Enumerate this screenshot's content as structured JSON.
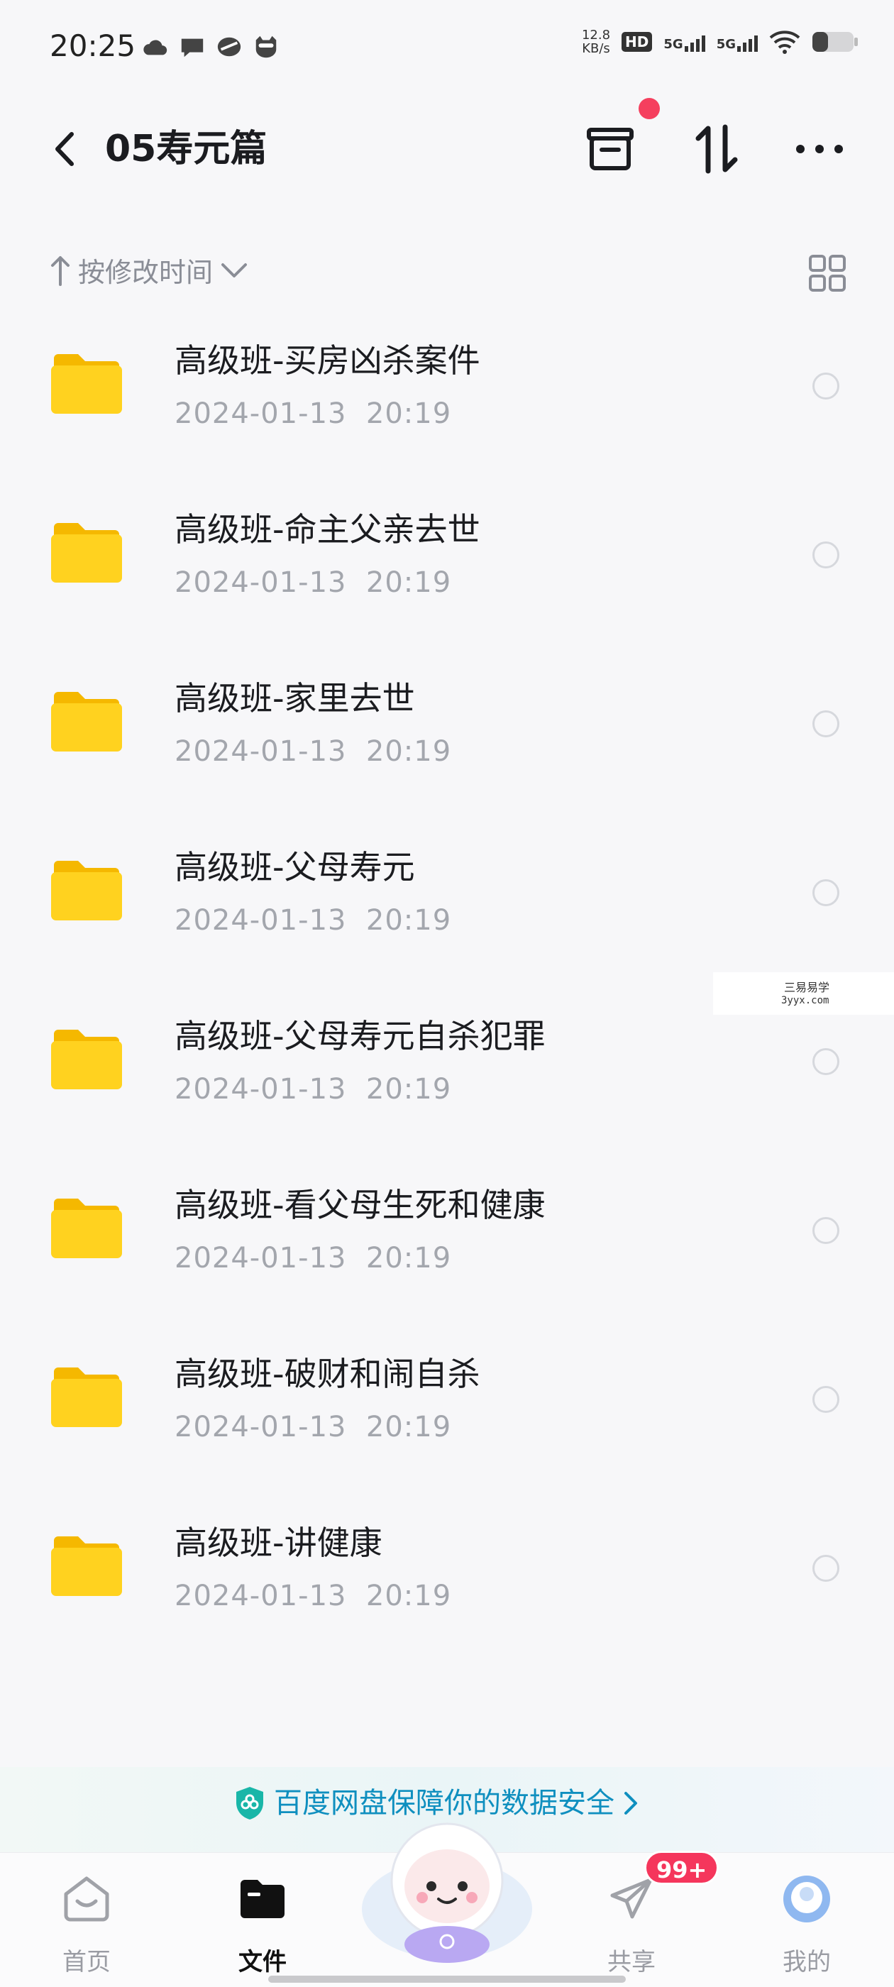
{
  "status_bar": {
    "time": "20:25",
    "net_speed_value": "12.8",
    "net_speed_unit": "KB/s",
    "hd_label": "HD",
    "sim1_label": "5G",
    "sim2_label": "5G",
    "left_icons": [
      "cloud-icon",
      "chat-icon",
      "app-icon",
      "cat-icon"
    ],
    "battery_level": 0.35
  },
  "header": {
    "title": "05寿元篇",
    "back_icon": "chevron-left-icon",
    "actions": [
      "inbox-icon",
      "sort-arrows-icon",
      "more-icon"
    ],
    "notification_dot_color": "#f53f5e"
  },
  "sort": {
    "label": "按修改时间",
    "direction_icon": "arrow-up-icon",
    "dropdown_icon": "chevron-down-icon",
    "view_toggle_icon": "grid-view-icon"
  },
  "files": [
    {
      "name": "高级班-买房凶杀案件",
      "date": "2024-01-13",
      "time": "20:19"
    },
    {
      "name": "高级班-命主父亲去世",
      "date": "2024-01-13",
      "time": "20:19"
    },
    {
      "name": "高级班-家里去世",
      "date": "2024-01-13",
      "time": "20:19"
    },
    {
      "name": "高级班-父母寿元",
      "date": "2024-01-13",
      "time": "20:19"
    },
    {
      "name": "高级班-父母寿元自杀犯罪",
      "date": "2024-01-13",
      "time": "20:19"
    },
    {
      "name": "高级班-看父母生死和健康",
      "date": "2024-01-13",
      "time": "20:19"
    },
    {
      "name": "高级班-破财和闹自杀",
      "date": "2024-01-13",
      "time": "20:19"
    },
    {
      "name": "高级班-讲健康",
      "date": "2024-01-13",
      "time": "20:19"
    }
  ],
  "watermark": {
    "line1": "三易易学",
    "line2": "3yyx.com"
  },
  "banner": {
    "text": "百度网盘保障你的数据安全",
    "icon": "shield-icon"
  },
  "tabs": [
    {
      "label": "首页",
      "icon": "home-icon"
    },
    {
      "label": "文件",
      "icon": "folder-icon"
    },
    {
      "label": "共享",
      "icon": "send-icon"
    },
    {
      "label": "我的",
      "icon": "avatar-icon"
    }
  ],
  "share_badge": "99+",
  "colors": {
    "accent": "#0f8fbf",
    "folder": "#ffd21f",
    "badge": "#f5365c"
  }
}
